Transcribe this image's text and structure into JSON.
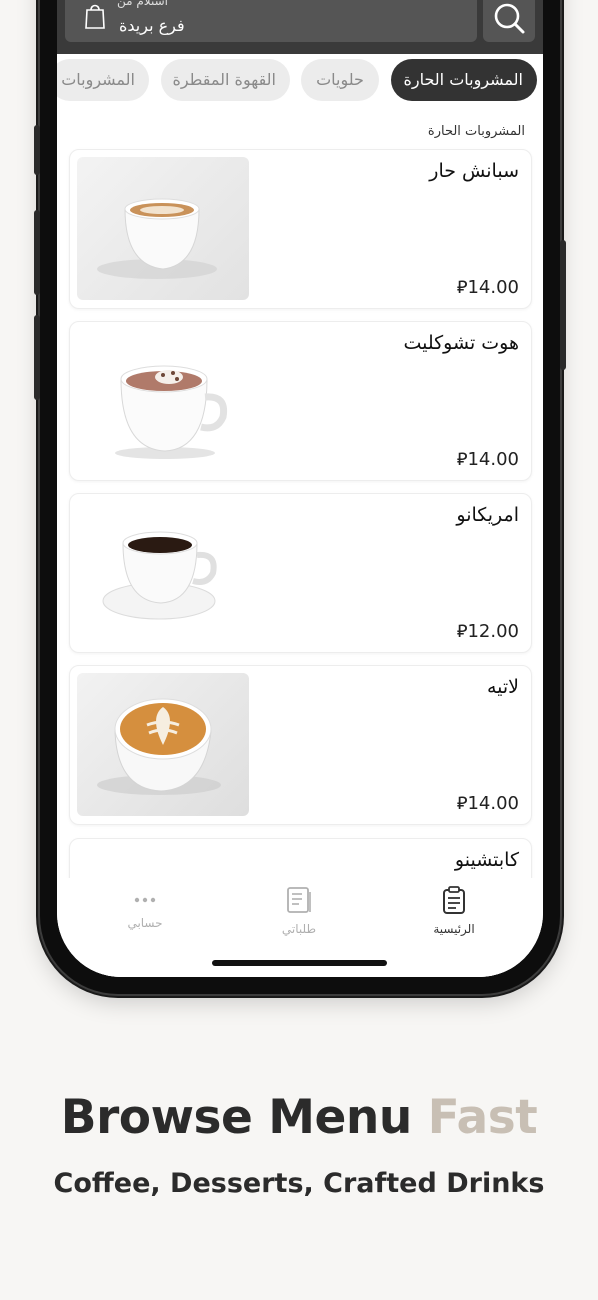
{
  "header": {
    "pickup_label": "استلام من",
    "branch_name": "فرع بريدة"
  },
  "categories": [
    {
      "label": "المشروبات الحارة",
      "active": true
    },
    {
      "label": "حلويات",
      "active": false
    },
    {
      "label": "القهوة المقطرة",
      "active": false
    },
    {
      "label": "المشروبات",
      "active": false
    }
  ],
  "section_title": "المشروبات الحارة",
  "currency_symbol": "⃁",
  "products": [
    {
      "name": "سبانش حار",
      "price": "14.00",
      "image": "coffee-cup"
    },
    {
      "name": "هوت تشوكليت",
      "price": "14.00",
      "image": "hot-chocolate"
    },
    {
      "name": "امريكانو",
      "price": "12.00",
      "image": "black-coffee"
    },
    {
      "name": "لاتيه",
      "price": "14.00",
      "image": "latte-art"
    },
    {
      "name": "كابتشينو",
      "price": "",
      "image": ""
    }
  ],
  "nav": {
    "account": "حسابي",
    "orders": "طلباتي",
    "home": "الرئيسية"
  },
  "marketing": {
    "headline_main": "Browse Menu",
    "headline_accent": "Fast",
    "subheadline": "Coffee, Desserts, Crafted Drinks"
  },
  "colors": {
    "dark": "#333333",
    "accent": "#c8bfb4"
  }
}
